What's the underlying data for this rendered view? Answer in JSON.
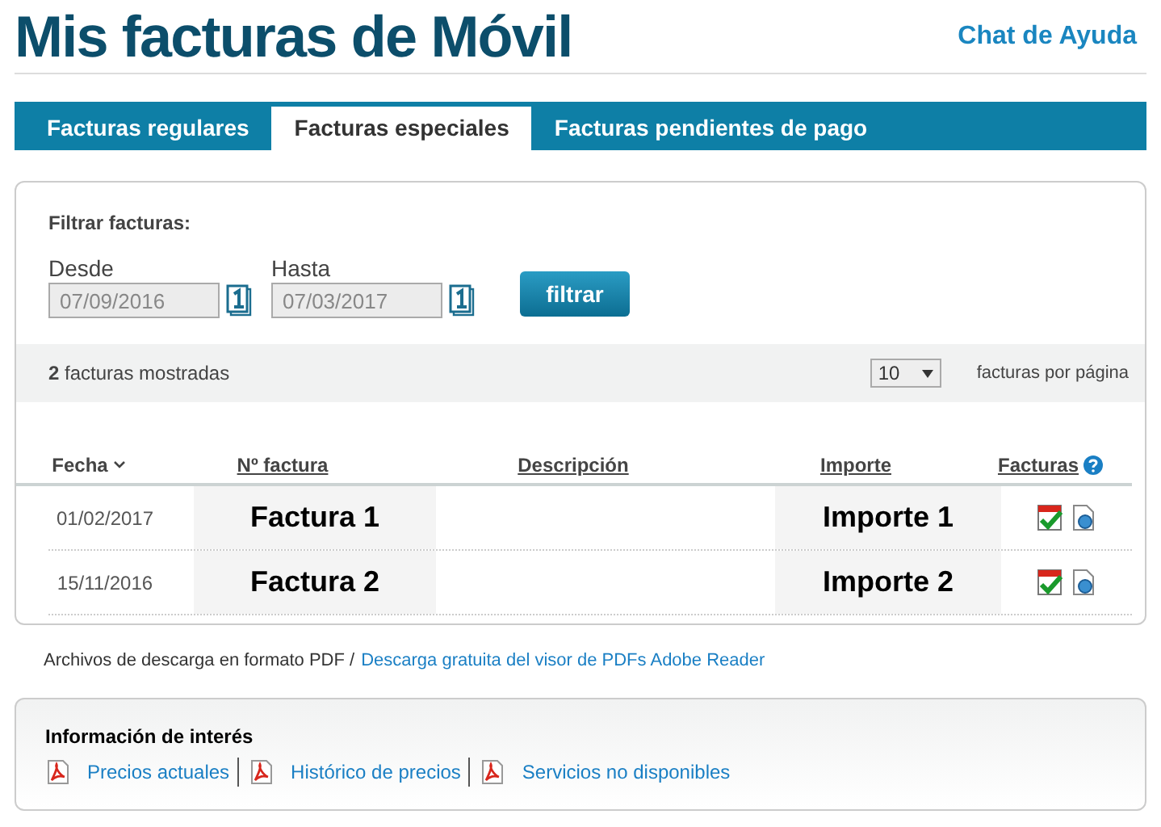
{
  "title": "Mis facturas de Móvil",
  "help_link": "Chat de Ayuda",
  "tabs": [
    {
      "label": "Facturas regulares",
      "selected": false
    },
    {
      "label": "Facturas especiales",
      "selected": true
    },
    {
      "label": "Facturas pendientes de pago",
      "selected": false
    }
  ],
  "filter": {
    "label": "Filtrar facturas:",
    "fields": [
      {
        "label": "Desde",
        "value": "07/09/2016"
      },
      {
        "label": "Hasta",
        "value": "07/03/2017"
      }
    ],
    "button": "filtrar"
  },
  "summary": {
    "text": "**2** facturas mostradas",
    "page_size": "10",
    "per_page_label": "facturas por página"
  },
  "table": {
    "columns": [
      {
        "label": "Fecha",
        "sorted": true,
        "help": false
      },
      {
        "label": "Nº factura",
        "sorted": false,
        "help": false
      },
      {
        "label": "Descripción",
        "sorted": false,
        "help": false
      },
      {
        "label": "Importe",
        "sorted": false,
        "help": false
      },
      {
        "label": "Facturas",
        "sorted": false,
        "help": true
      }
    ],
    "rows": [
      {
        "fecha": "01/02/2017",
        "numero": "Factura 1",
        "importe": "Importe 1"
      },
      {
        "fecha": "15/11/2016",
        "numero": "Factura 2",
        "importe": "Importe 2"
      }
    ]
  },
  "footer": {
    "text": "Archivos de descarga en formato PDF /",
    "link": "Descarga gratuita del visor de PDFs Adobe Reader"
  },
  "info": {
    "title": "Información de interés",
    "links": [
      "Precios actuales",
      "Histórico de precios",
      "Servicios no disponibles"
    ]
  }
}
